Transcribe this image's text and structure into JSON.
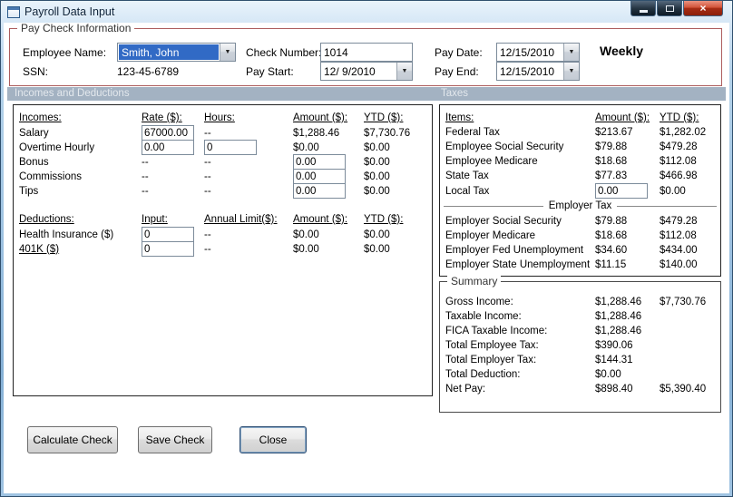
{
  "colors": {
    "group_border": "#ad5e5e",
    "section_band": "#a3b2c2",
    "section_text": "#e3e8ed",
    "selection_bg": "#316ac5",
    "selection_text": "#ffffff",
    "panel_border": "#222222"
  },
  "window": {
    "title": "Payroll Data Input",
    "close_glyph": "×"
  },
  "paycheck": {
    "legend": "Pay Check Information",
    "employee_name": {
      "label": "Employee Name:",
      "value": "Smith, John"
    },
    "ssn": {
      "label": "SSN:",
      "value": "123-45-6789"
    },
    "check_number": {
      "label": "Check Number:",
      "value": "1014"
    },
    "pay_start": {
      "label": "Pay Start:",
      "value": "12/ 9/2010"
    },
    "pay_date": {
      "label": "Pay Date:",
      "value": "12/15/2010"
    },
    "pay_end": {
      "label": "Pay End:",
      "value": "12/15/2010"
    },
    "frequency": "Weekly"
  },
  "section_headers": {
    "left": "Incomes and Deductions",
    "right": "Taxes"
  },
  "incomes": {
    "headers": {
      "c0": "Incomes:",
      "c1": "Rate ($):",
      "c2": "Hours:",
      "c3": "Amount ($):",
      "c4": "YTD ($):"
    },
    "salary": {
      "label": "Salary",
      "rate": "67000.00",
      "hours": "--",
      "amount": "$1,288.46",
      "ytd": "$7,730.76"
    },
    "overtime": {
      "label": "Overtime Hourly",
      "rate": "0.00",
      "hours": "0",
      "amount": "$0.00",
      "ytd": "$0.00"
    },
    "bonus": {
      "label": "Bonus",
      "rate": "--",
      "hours": "--",
      "amount": "0.00",
      "ytd": "$0.00"
    },
    "commissions": {
      "label": "Commissions",
      "rate": "--",
      "hours": "--",
      "amount": "0.00",
      "ytd": "$0.00"
    },
    "tips": {
      "label": "Tips",
      "rate": "--",
      "hours": "--",
      "amount": "0.00",
      "ytd": "$0.00"
    }
  },
  "deductions": {
    "headers": {
      "c0": "Deductions:",
      "c1": "Input:",
      "c2": "Annual Limit($):",
      "c3": "Amount ($):",
      "c4": "YTD ($):"
    },
    "health": {
      "label": "Health Insurance ($)",
      "input": "0",
      "limit": "--",
      "amount": "$0.00",
      "ytd": "$0.00"
    },
    "k401": {
      "label": "401K ($)",
      "input": "0",
      "limit": "--",
      "amount": "$0.00",
      "ytd": "$0.00"
    }
  },
  "taxes": {
    "headers": {
      "c0": "Items:",
      "c1": "Amount ($):",
      "c2": "YTD ($):"
    },
    "federal": {
      "label": "Federal Tax",
      "amount": "$213.67",
      "ytd": "$1,282.02"
    },
    "emp_ss": {
      "label": "Employee Social Security",
      "amount": "$79.88",
      "ytd": "$479.28"
    },
    "emp_medicare": {
      "label": "Employee Medicare",
      "amount": "$18.68",
      "ytd": "$112.08"
    },
    "state": {
      "label": "State Tax",
      "amount": "$77.83",
      "ytd": "$466.98"
    },
    "local": {
      "label": "Local Tax",
      "amount": "0.00",
      "ytd": "$0.00"
    },
    "divider": "Employer Tax",
    "er_ss": {
      "label": "Employer Social Security",
      "amount": "$79.88",
      "ytd": "$479.28"
    },
    "er_medicare": {
      "label": "Employer Medicare",
      "amount": "$18.68",
      "ytd": "$112.08"
    },
    "er_fed_unemp": {
      "label": "Employer Fed Unemployment",
      "amount": "$34.60",
      "ytd": "$434.00"
    },
    "er_state_unemp": {
      "label": "Employer State Unemployment",
      "amount": "$11.15",
      "ytd": "$140.00"
    }
  },
  "summary": {
    "legend": "Summary",
    "gross": {
      "label": "Gross Income:",
      "amount": "$1,288.46",
      "ytd": "$7,730.76"
    },
    "taxable": {
      "label": "Taxable Income:",
      "amount": "$1,288.46"
    },
    "fica": {
      "label": "FICA Taxable Income:",
      "amount": "$1,288.46"
    },
    "total_emp": {
      "label": "Total Employee Tax:",
      "amount": "$390.06"
    },
    "total_er": {
      "label": "Total Employer Tax:",
      "amount": "$144.31"
    },
    "total_ded": {
      "label": "Total Deduction:",
      "amount": "$0.00"
    },
    "net_pay": {
      "label": "Net Pay:",
      "amount": "$898.40",
      "ytd": "$5,390.40"
    }
  },
  "buttons": {
    "calculate": "Calculate Check",
    "save": "Save Check",
    "close": "Close"
  }
}
